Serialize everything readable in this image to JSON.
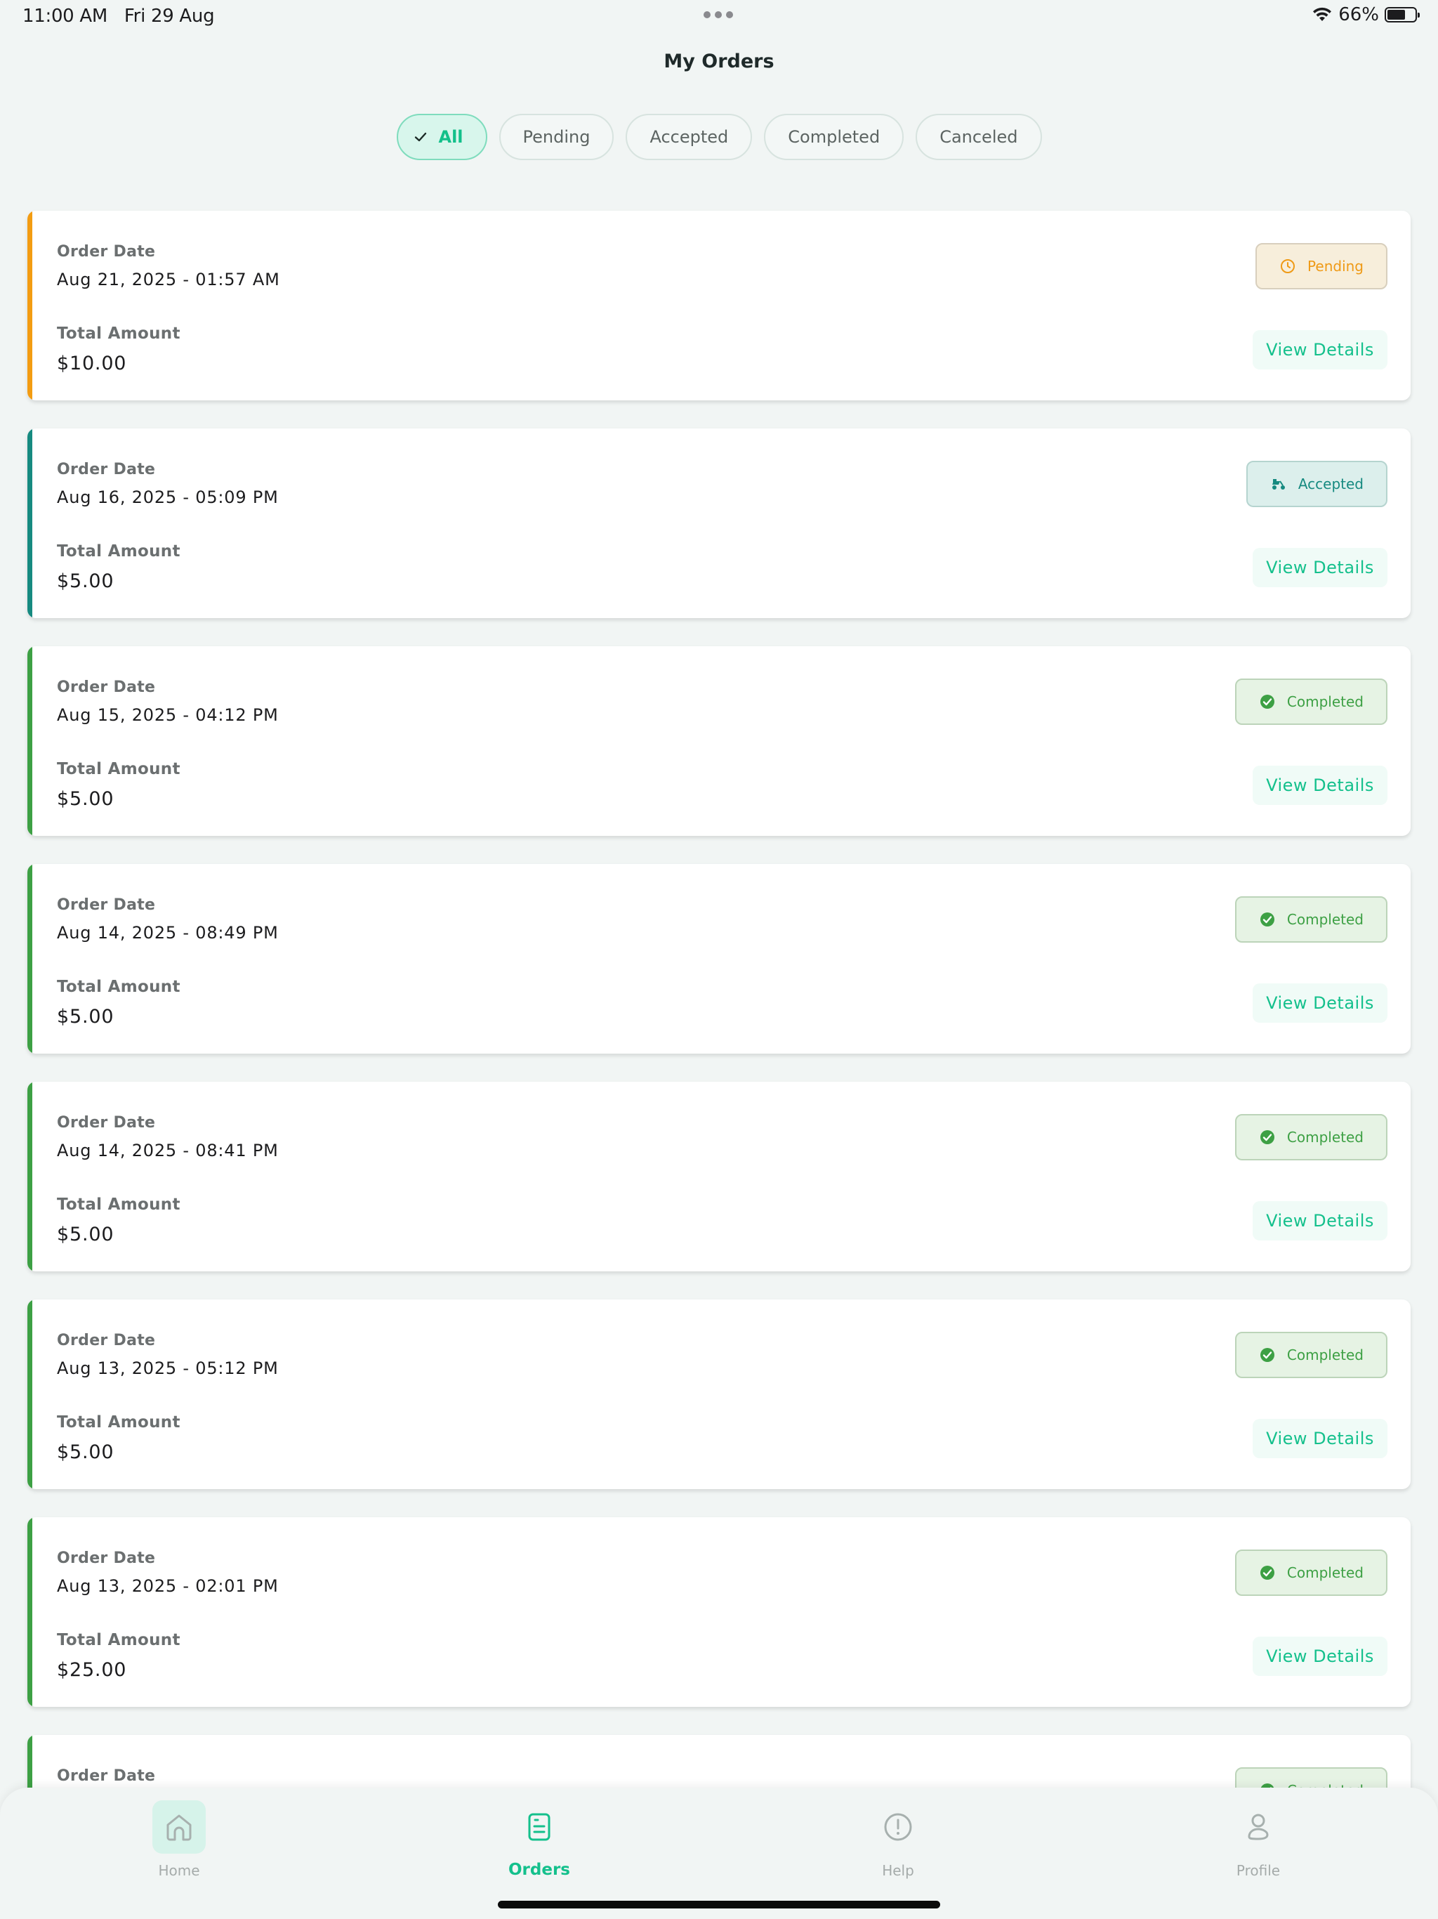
{
  "status_bar": {
    "time": "11:00 AM",
    "date": "Fri 29 Aug",
    "battery": "66%",
    "battery_level": 0.66
  },
  "header": {
    "title": "My Orders"
  },
  "filters": [
    {
      "label": "All",
      "active": true
    },
    {
      "label": "Pending",
      "active": false
    },
    {
      "label": "Accepted",
      "active": false
    },
    {
      "label": "Completed",
      "active": false
    },
    {
      "label": "Canceled",
      "active": false
    }
  ],
  "order_labels": {
    "date_label": "Order Date",
    "amount_label": "Total Amount",
    "details_label": "View Details"
  },
  "orders": [
    {
      "date": "Aug 21, 2025 - 01:57 AM",
      "amount": "$10.00",
      "status": "Pending",
      "status_key": "pending",
      "status_icon": "clock-icon",
      "accent": "#f39c12"
    },
    {
      "date": "Aug 16, 2025 - 05:09 PM",
      "amount": "$5.00",
      "status": "Accepted",
      "status_key": "accepted",
      "status_icon": "scooter-icon",
      "accent": "#168a80"
    },
    {
      "date": "Aug 15, 2025 - 04:12 PM",
      "amount": "$5.00",
      "status": "Completed",
      "status_key": "completed",
      "status_icon": "check-circle-icon",
      "accent": "#3da044"
    },
    {
      "date": "Aug 14, 2025 - 08:49 PM",
      "amount": "$5.00",
      "status": "Completed",
      "status_key": "completed",
      "status_icon": "check-circle-icon",
      "accent": "#3da044"
    },
    {
      "date": "Aug 14, 2025 - 08:41 PM",
      "amount": "$5.00",
      "status": "Completed",
      "status_key": "completed",
      "status_icon": "check-circle-icon",
      "accent": "#3da044"
    },
    {
      "date": "Aug 13, 2025 - 05:12 PM",
      "amount": "$5.00",
      "status": "Completed",
      "status_key": "completed",
      "status_icon": "check-circle-icon",
      "accent": "#3da044"
    },
    {
      "date": "Aug 13, 2025 - 02:01 PM",
      "amount": "$25.00",
      "status": "Completed",
      "status_key": "completed",
      "status_icon": "check-circle-icon",
      "accent": "#3da044"
    },
    {
      "date": "",
      "amount": "",
      "status": "Completed",
      "status_key": "completed",
      "status_icon": "check-circle-icon",
      "accent": "#3da044"
    }
  ],
  "tabbar": {
    "home": "Home",
    "orders": "Orders",
    "help": "Help",
    "profile": "Profile"
  },
  "colors": {
    "brand": "#14c08c",
    "pending": "#ef9a16",
    "accepted": "#168a80",
    "completed": "#3da044"
  }
}
